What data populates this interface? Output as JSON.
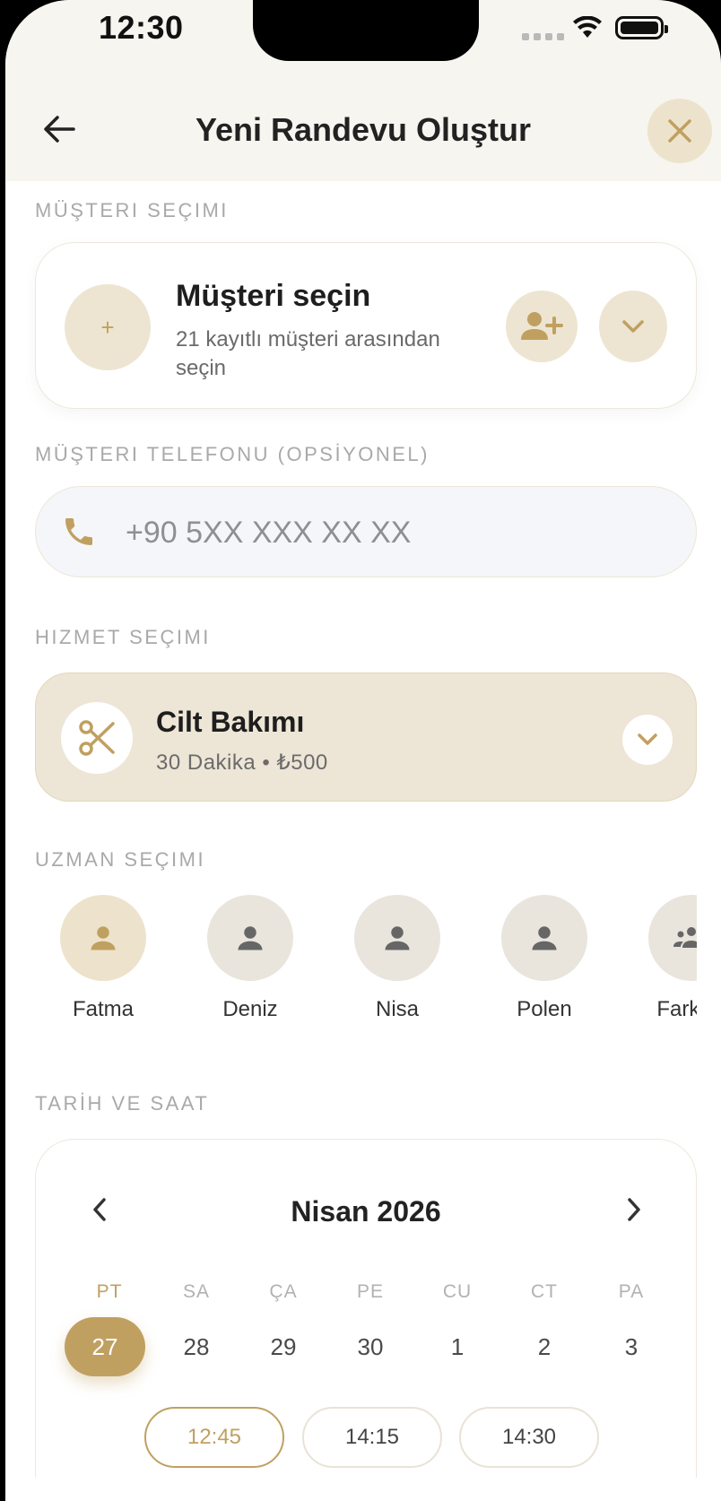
{
  "status_bar": {
    "time": "12:30"
  },
  "header": {
    "title": "Yeni Randevu Oluştur"
  },
  "customer_section": {
    "label": "MÜŞTERI SEÇIMI",
    "plus_symbol": "+",
    "title": "Müşteri seçin",
    "subtitle": "21 kayıtlı müşteri arasından seçin"
  },
  "phone_section": {
    "label": "MÜŞTERI TELEFONU (OPSİYONEL)",
    "placeholder": "+90 5XX XXX XX XX",
    "value": ""
  },
  "service_section": {
    "label": "HIZMET SEÇIMI",
    "service_name": "Cilt Bakımı",
    "service_meta": "30 Dakika • ₺500"
  },
  "expert_section": {
    "label": "UZMAN SEÇIMI",
    "experts": [
      {
        "name": "Fatma",
        "icon": "person-icon",
        "selected": true
      },
      {
        "name": "Deniz",
        "icon": "person-icon",
        "selected": false
      },
      {
        "name": "Nisa",
        "icon": "person-icon",
        "selected": false
      },
      {
        "name": "Polen",
        "icon": "person-icon",
        "selected": false
      },
      {
        "name": "Fark Et",
        "icon": "group-icon",
        "selected": false
      }
    ]
  },
  "date_section": {
    "label": "TARİH VE SAAT",
    "month_title": "Nisan 2026",
    "weekdays": [
      "PT",
      "SA",
      "ÇA",
      "PE",
      "CU",
      "CT",
      "PA"
    ],
    "days": [
      "27",
      "28",
      "29",
      "30",
      "1",
      "2",
      "3"
    ],
    "selected_day": "27",
    "times": [
      "12:45",
      "14:15",
      "14:30"
    ],
    "selected_time": "12:45"
  },
  "colors": {
    "accent": "#c0a060",
    "accent_light": "#ede5d2",
    "header_bg": "#f7f5ef"
  }
}
